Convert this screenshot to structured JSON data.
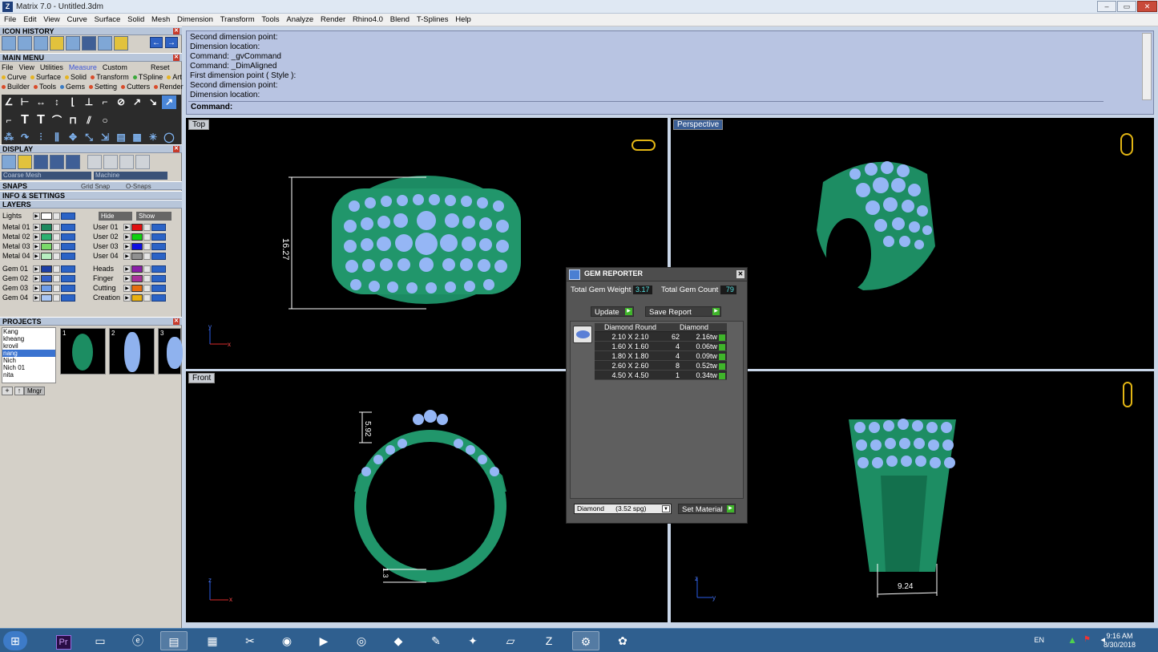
{
  "window": {
    "title": "Matrix 7.0 - Untitled.3dm",
    "controls": [
      "–",
      "▭",
      "✕"
    ]
  },
  "menu": [
    "File",
    "Edit",
    "View",
    "Curve",
    "Surface",
    "Solid",
    "Mesh",
    "Dimension",
    "Transform",
    "Tools",
    "Analyze",
    "Render",
    "Rhino4.0",
    "Blend",
    "T-Splines",
    "Help"
  ],
  "left": {
    "icon_history": "ICON HISTORY",
    "main_menu": "MAIN MENU",
    "tabs": [
      "File",
      "View",
      "Utilities",
      "Measure",
      "Custom"
    ],
    "reset": "Reset",
    "categories_row1": [
      {
        "label": "Curve",
        "color": "#e6b422"
      },
      {
        "label": "Surface",
        "color": "#e6b422"
      },
      {
        "label": "Solid",
        "color": "#e6b422"
      },
      {
        "label": "Transform",
        "color": "#d94c2a"
      },
      {
        "label": "TSpline",
        "color": "#3aa83a"
      },
      {
        "label": "Art",
        "color": "#e6b422"
      }
    ],
    "categories_row2": [
      {
        "label": "Builder",
        "color": "#d94c2a"
      },
      {
        "label": "Tools",
        "color": "#d94c2a"
      },
      {
        "label": "Gems",
        "color": "#3a7cc4"
      },
      {
        "label": "Setting",
        "color": "#d94c2a"
      },
      {
        "label": "Cutters",
        "color": "#d94c2a"
      },
      {
        "label": "Render",
        "color": "#d94c2a"
      }
    ],
    "display": "DISPLAY",
    "mesh_select": "Coarse Mesh",
    "machine_select": "Machine",
    "snaps": "SNAPS",
    "grid_snap": "Grid Snap",
    "o_snaps": "O-Snaps",
    "info_settings": "INFO & SETTINGS",
    "layers": "LAYERS",
    "lights": "Lights",
    "hide": "Hide",
    "show": "Show",
    "layer_left": [
      {
        "name": "Metal 01",
        "color": "#1e8a5e"
      },
      {
        "name": "Metal 02",
        "color": "#2cb070"
      },
      {
        "name": "Metal 03",
        "color": "#7bd96a"
      },
      {
        "name": "Metal 04",
        "color": "#b7eec0"
      },
      {
        "name": "Gem 01",
        "color": "#1d3fa6"
      },
      {
        "name": "Gem 02",
        "color": "#3561c9"
      },
      {
        "name": "Gem 03",
        "color": "#6f9de8"
      },
      {
        "name": "Gem 04",
        "color": "#a9c6f3"
      }
    ],
    "layer_right": [
      {
        "name": "User 01",
        "color": "#e01010"
      },
      {
        "name": "User 02",
        "color": "#10d010"
      },
      {
        "name": "User 03",
        "color": "#1010e0"
      },
      {
        "name": "User 04",
        "color": "#909090"
      },
      {
        "name": "Heads",
        "color": "#8a1fa8"
      },
      {
        "name": "Finger",
        "color": "#a8329a"
      },
      {
        "name": "Cutting",
        "color": "#e56d10"
      },
      {
        "name": "Creation",
        "color": "#e8b010"
      }
    ],
    "projects": "PROJECTS",
    "project_names": [
      "Kang",
      "kheang",
      "krovil",
      "nang",
      "Nich",
      "Nich 01",
      "nita",
      "..."
    ],
    "selected_project": "nang",
    "thumb_numbers": [
      "1",
      "2",
      "3"
    ],
    "mngr": "Mngr"
  },
  "command": {
    "history": [
      "Second dimension point:",
      "Dimension location:",
      "Command: _gvCommand",
      "Command: _DimAligned",
      "First dimension point ( Style ):",
      "Second dimension point:",
      "Dimension location:"
    ],
    "prompt": "Command:"
  },
  "viewports": {
    "top": {
      "label": "Top",
      "dimension": "16.27",
      "axis_x": "x",
      "axis_y": "y"
    },
    "perspective": {
      "label": "Perspective"
    },
    "front": {
      "label": "Front",
      "dimension_a": "5.92",
      "dimension_b": "1.3",
      "axis_x": "x",
      "axis_y": "z"
    },
    "right": {
      "dimension": "9.24",
      "axis_x": "y",
      "axis_y": "z"
    }
  },
  "gem_reporter": {
    "title": "GEM REPORTER",
    "total_weight_label": "Total Gem Weight",
    "total_weight": "3.17",
    "total_count_label": "Total Gem Count",
    "total_count": "79",
    "update": "Update",
    "save_report": "Save Report",
    "col_shape": "Diamond Round",
    "col_material": "Diamond",
    "rows": [
      {
        "size": "2.10 X 2.10",
        "count": "62",
        "weight": "2.16tw"
      },
      {
        "size": "1.60 X 1.60",
        "count": "4",
        "weight": "0.06tw"
      },
      {
        "size": "1.80 X 1.80",
        "count": "4",
        "weight": "0.09tw"
      },
      {
        "size": "2.60 X 2.60",
        "count": "8",
        "weight": "0.52tw"
      },
      {
        "size": "4.50 X 4.50",
        "count": "1",
        "weight": "0.34tw"
      }
    ],
    "material_select": "Diamond      (3.52 spg)",
    "set_material": "Set Material"
  },
  "taskbar": {
    "language": "EN",
    "time": "9:16 AM",
    "date": "8/30/2018",
    "premiere": "Pr"
  }
}
